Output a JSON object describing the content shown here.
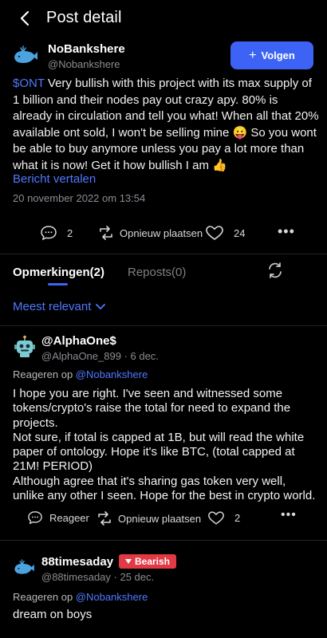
{
  "header": {
    "title": "Post detail"
  },
  "post": {
    "author": "NoBankshere",
    "handle": "@Nobankshere",
    "follow_label": "Volgen",
    "cashtag": "$ONT",
    "body": " Very bullish with this project with its max supply of 1 billion and their nodes pay out crazy apy. 80% is already in circulation and tell you what! When all that 20% available ont sold, I won't be selling mine 😛 So you wont be able to buy anymore unless you pay a lot more than what it is now! Get it how bullish I am 👍",
    "translate_label": "Bericht vertalen",
    "date": "20 november 2022 om 13:54",
    "comments_count": "2",
    "repost_label": "Opnieuw plaatsen",
    "likes_count": "24"
  },
  "tabs": {
    "comments": "Opmerkingen(2)",
    "reposts": "Reposts(0)"
  },
  "sort": {
    "label": "Meest relevant"
  },
  "comments": [
    {
      "name": "@AlphaOne$",
      "handle": "@AlphaOne_899",
      "time": "· 6 dec.",
      "reply_prefix": "Reageren op ",
      "reply_mention": "@Nobankshere",
      "body_lines": [
        "I hope you are right. I've seen and witnessed some tokens/crypto's raise the total for need to expand the projects.",
        "Not sure, if total is capped at 1B, but will read the white paper of ontology. Hope it's like BTC, (total capped at 21M! PERIOD)",
        "Although agree that it's sharing gas token very well, unlike any other I seen. Hope for the best in crypto world."
      ],
      "reply_label": "Reageer",
      "repost_label": "Opnieuw plaatsen",
      "likes": "2"
    },
    {
      "name": "88timesaday",
      "badge": "Bearish",
      "handle": "@88timesaday",
      "time": "· 25 dec.",
      "reply_prefix": "Reageren op ",
      "reply_mention": "@Nobankshere",
      "body_lines": [
        "dream on boys"
      ]
    }
  ],
  "colors": {
    "accent": "#3d63f5",
    "link": "#4f79ff",
    "bearish": "#e13a45",
    "bg": "#000000"
  }
}
